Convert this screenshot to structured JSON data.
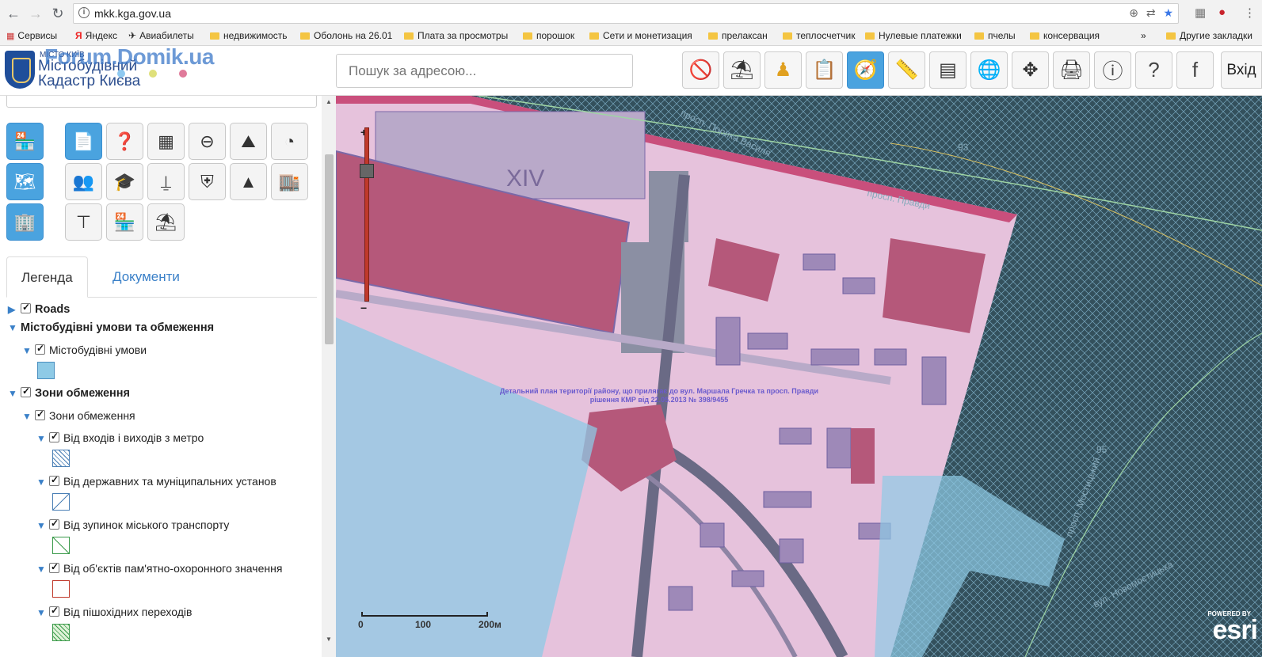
{
  "browser": {
    "url": "mkk.kga.gov.ua",
    "bookmarks": [
      "Сервисы",
      "Яндекс",
      "Авиабилеты",
      "недвижимость",
      "Оболонь на 26.01",
      "Плата за просмотры",
      "порошок",
      "Сети и монетизация",
      "прелаксан",
      "теплосчетчик",
      "Нулевые платежки",
      "пчелы",
      "консервация",
      "Другие закладки"
    ],
    "more": "»"
  },
  "header": {
    "logo_small": "МІСТО КИЇВ",
    "logo_line1": "Містобудівний",
    "logo_line2": "Кадастр Києва",
    "watermark": "Forum.Domik.ua",
    "search_placeholder": "Пошук за адресою...",
    "login": "Вхід"
  },
  "tabs": {
    "legend": "Легенда",
    "documents": "Документи"
  },
  "legend": {
    "roads": "Roads",
    "urban_conditions_group": "Містобудівні умови та обмеження",
    "urban_conditions": "Містобудівні умови",
    "restriction_group": "Зони обмеження",
    "restriction_sub": "Зони обмеження",
    "metro": "Від входів і виходів з метро",
    "state": "Від державних та муніципальних установ",
    "transport": "Від зупинок міського транспорту",
    "monuments": "Від об'єктів пам'ятно-охоронного значення",
    "crossings": "Від пішохідних переходів"
  },
  "map": {
    "block_label": "XIV",
    "plan_label_line1": "Детальний план території району, що прилягає до вул. Маршала Гречка та просп. Правди",
    "plan_label_line2": "рішення КМР від 22.05.2013 № 398/9455",
    "street_1": "просп. Порика Василя",
    "street_2": "просп. Правди",
    "street_3": "вул. Новомостицька",
    "street_4": "просп. Мостицький",
    "house_93": "93",
    "house_95": "95",
    "scale_0": "0",
    "scale_100": "100",
    "scale_200": "200м",
    "esri_powered": "POWERED BY",
    "esri": "esri"
  },
  "colors": {
    "accent": "#4aa3df",
    "zone_pink": "#e8c4dc",
    "zone_crimson": "#b5587a",
    "zone_blue": "#8ecae6",
    "map_dark": "#2f4650"
  }
}
